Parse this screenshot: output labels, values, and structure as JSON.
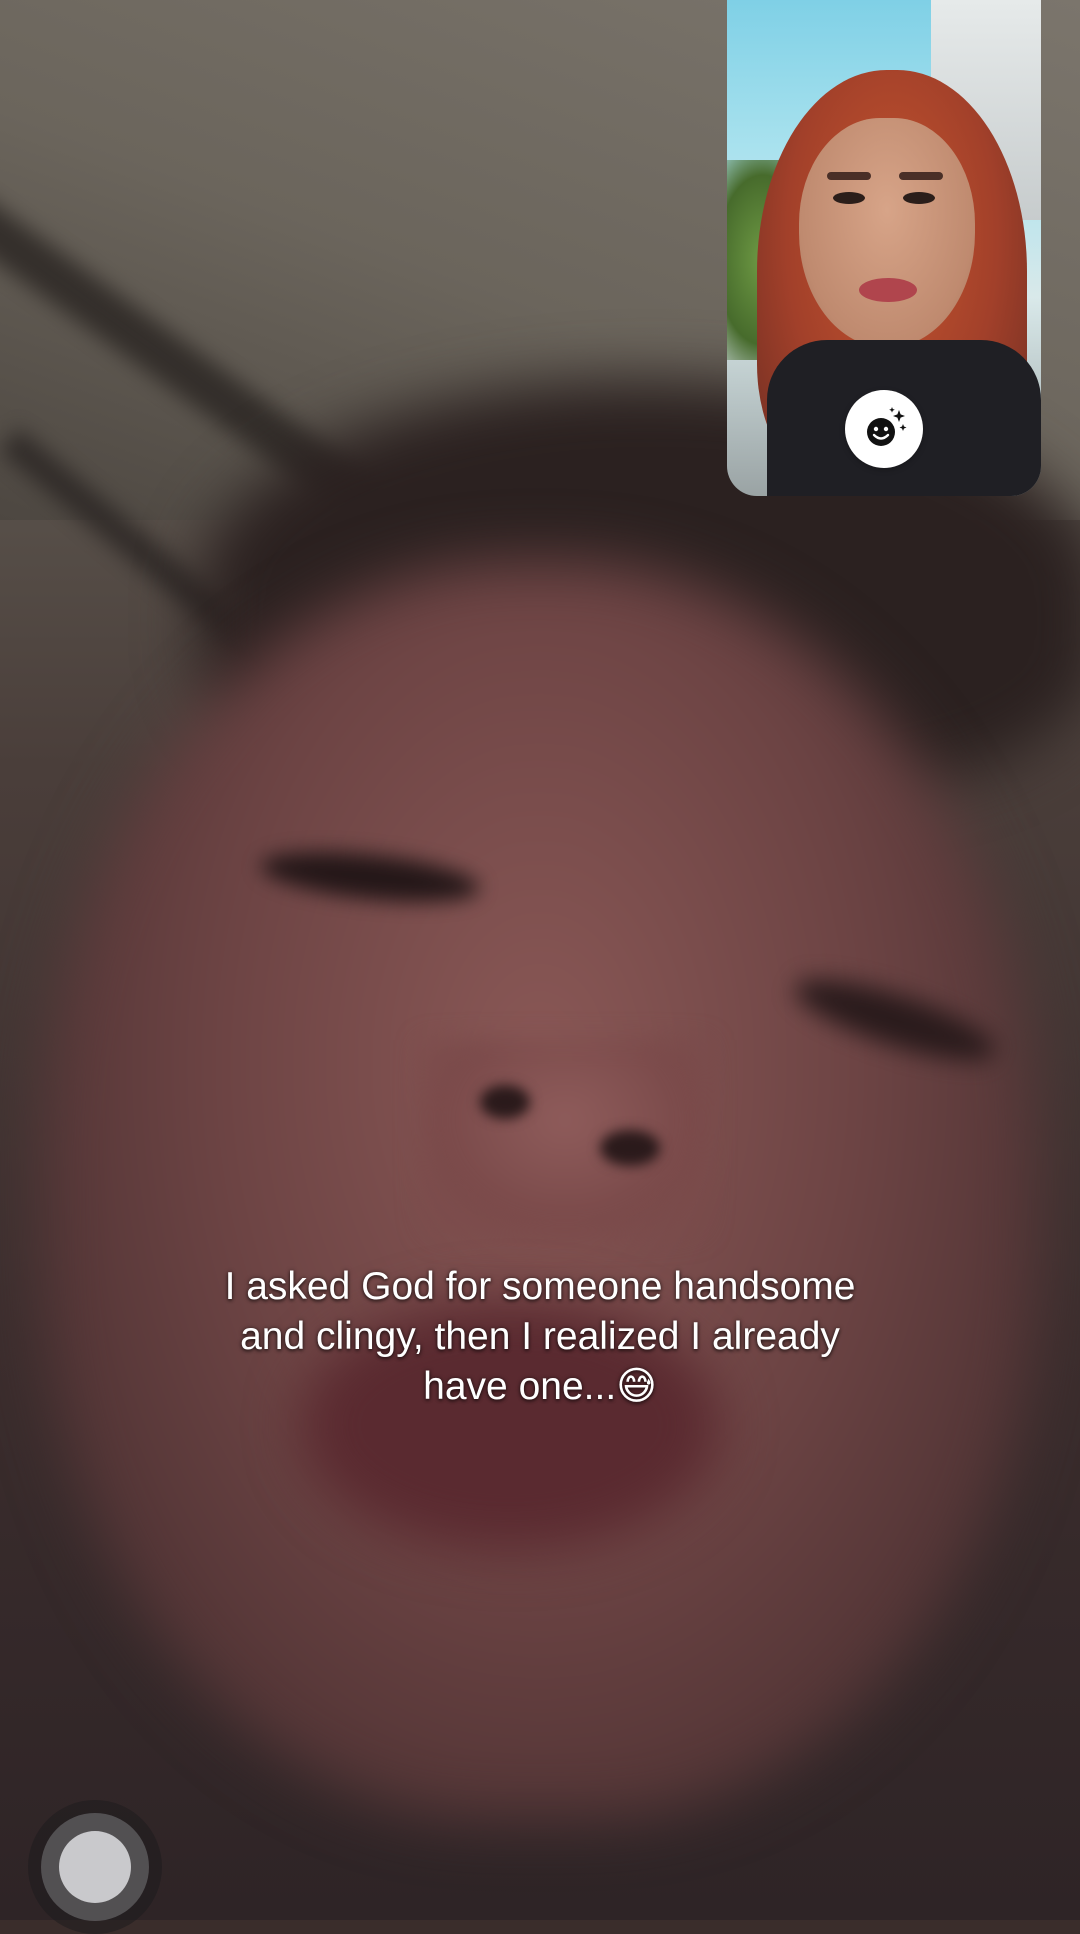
{
  "call": {
    "remote_video": {
      "description_icon": "camera-feed"
    },
    "self_view": {
      "effects_icon": "face-sparkles-icon"
    }
  },
  "caption": {
    "text": "I asked God for someone handsome\nand clingy, then I realized I already\nhave one...😅"
  },
  "assistive_touch": {
    "icon": "assistive-touch-icon"
  },
  "colors": {
    "caption_text": "#ffffff",
    "effects_button_bg": "#ffffff",
    "pip_hair": "#b5472b"
  }
}
